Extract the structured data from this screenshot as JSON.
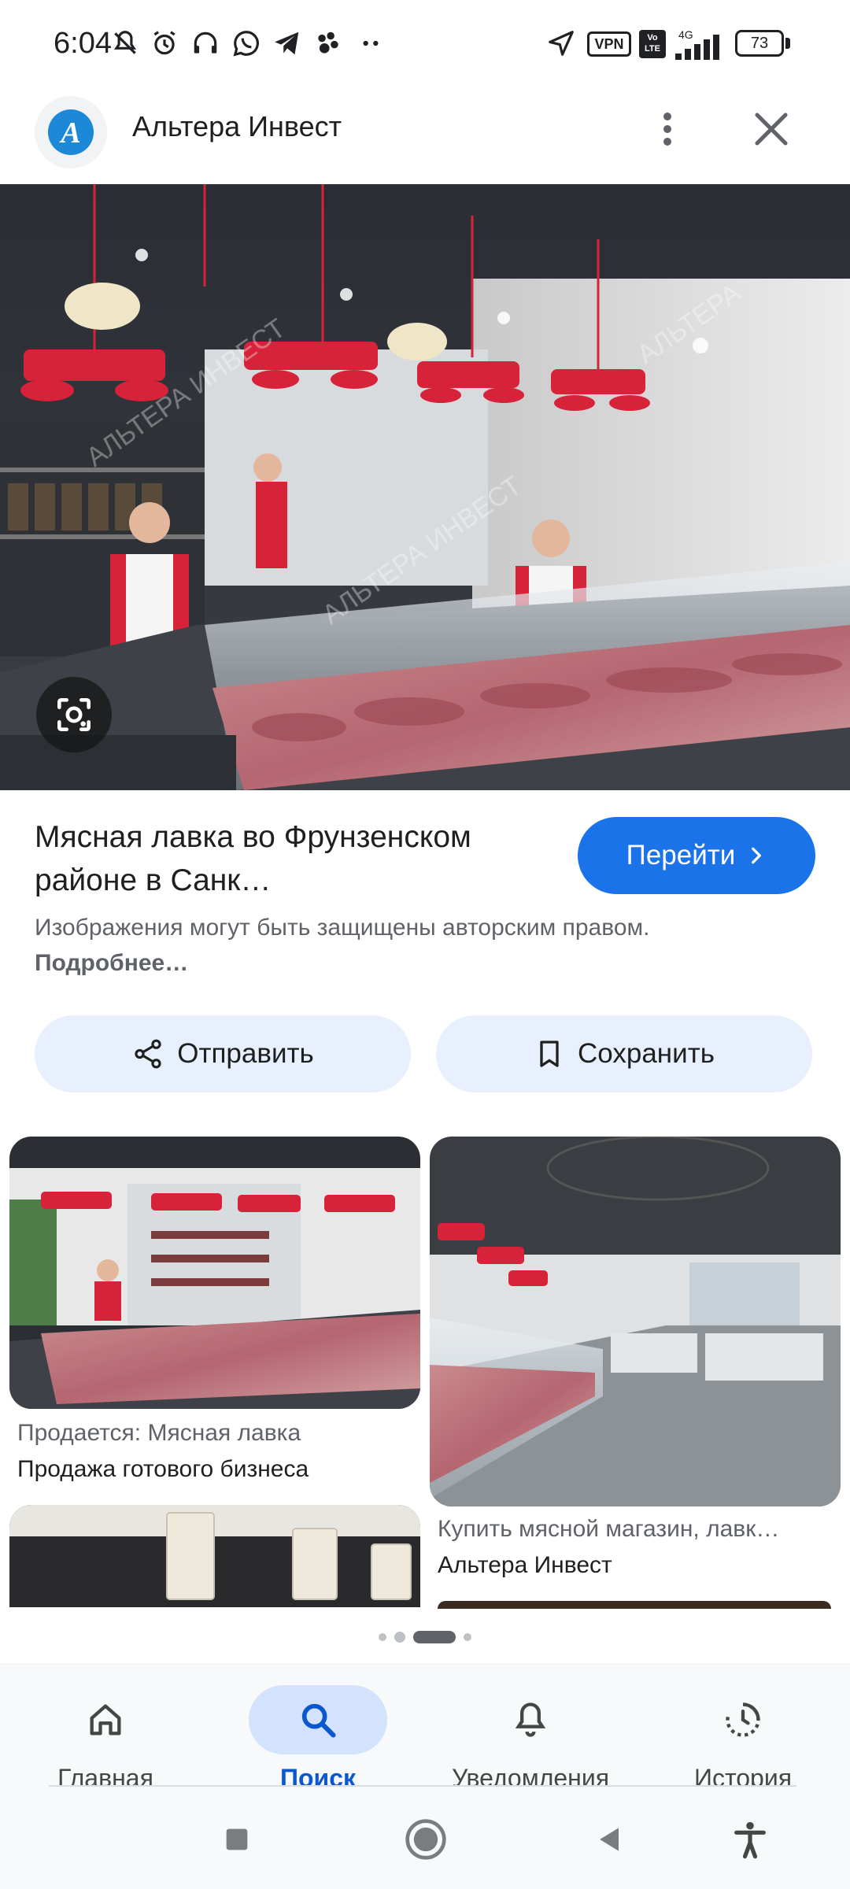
{
  "status_bar": {
    "time": "6:04",
    "battery": "73",
    "network": "4G",
    "vpn_label": "VPN",
    "volte_label": "Vo LTE",
    "left_icons": [
      "mute-bell-icon",
      "alarm-icon",
      "headset-icon",
      "whatsapp-icon",
      "telegram-icon",
      "paw-app-icon",
      "more-dots-icon"
    ],
    "right_icons": [
      "location-arrow-icon",
      "vpn-icon",
      "volte-icon",
      "signal-icon",
      "battery-icon"
    ]
  },
  "header": {
    "site_name": "Альтера Инвест",
    "logo_letter": "А",
    "icons": [
      "more-vertical-icon",
      "close-icon"
    ]
  },
  "result": {
    "title": "Мясная лавка во Фрунзенском районе в Санк…",
    "go_button": "Перейти",
    "copyright_text": "Изображения могут быть защищены авторским правом.",
    "copyright_link": "Подробнее…"
  },
  "actions": {
    "share": "Отправить",
    "save": "Сохранить"
  },
  "related": [
    {
      "title": "Продается: Мясная лавка",
      "source": "Продажа готового бизнеса"
    },
    {
      "title": "Купить мясной магазин, лавк…",
      "source": "Альтера Инвест"
    }
  ],
  "pager": {
    "count": 4,
    "active_index": 2
  },
  "bottom_nav": [
    {
      "label": "Главная",
      "icon": "home-icon",
      "active": false
    },
    {
      "label": "Поиск",
      "icon": "search-icon",
      "active": true
    },
    {
      "label": "Уведомления",
      "icon": "bell-icon",
      "active": false
    },
    {
      "label": "История",
      "icon": "history-icon",
      "active": false
    }
  ],
  "system_nav": [
    "recents-square-icon",
    "home-circle-icon",
    "back-triangle-icon",
    "accessibility-icon"
  ],
  "colors": {
    "accent": "#1a73e8",
    "action_bg": "#e8f0fe",
    "nav_active_pill": "#d3e3fd",
    "meat_red": "#d6233a"
  }
}
